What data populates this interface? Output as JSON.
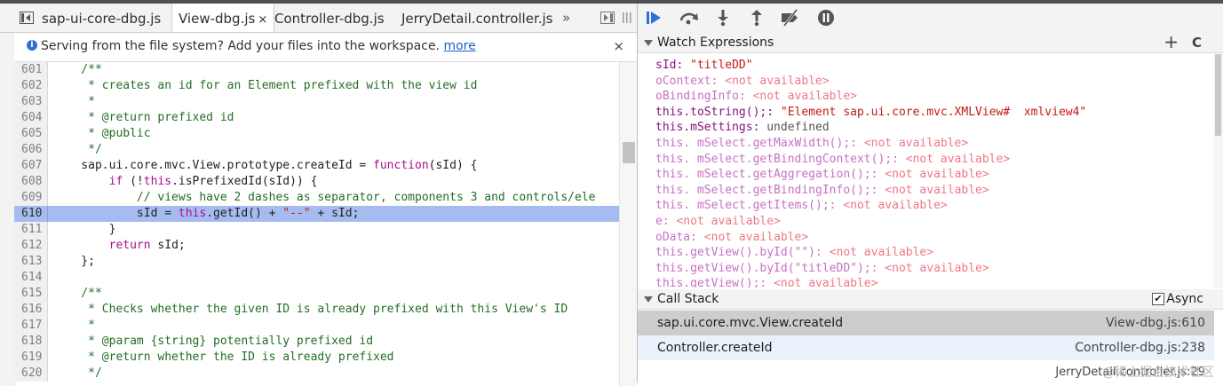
{
  "colors": {
    "highlight": "#a6bcf0",
    "comment": "#236e25",
    "keyword": "#aa0d91",
    "string": "#c41a16",
    "accent": "#2f6fd8"
  },
  "tabs": [
    {
      "label": "sap-ui-core-dbg.js",
      "active": false
    },
    {
      "label": "View-dbg.js",
      "active": true,
      "close": "×"
    },
    {
      "label": "Controller-dbg.js",
      "active": false
    },
    {
      "label": "JerryDetail.controller.js",
      "active": false
    }
  ],
  "tab_overflow": "»",
  "icons": {
    "navigator": "sidebar-toggle-icon",
    "debugger_toggle": "debugger-sidebar-icon",
    "info": "info-icon"
  },
  "infobar": {
    "text": "Serving from the file system? Add your files into the workspace.",
    "link": "more",
    "close": "×"
  },
  "code": {
    "lines": [
      {
        "n": "601",
        "tokens": [
          {
            "t": "    /**",
            "c": "comment"
          }
        ]
      },
      {
        "n": "602",
        "tokens": [
          {
            "t": "     * creates an id for an Element prefixed with the view id",
            "c": "comment"
          }
        ]
      },
      {
        "n": "603",
        "tokens": [
          {
            "t": "     *",
            "c": "comment"
          }
        ]
      },
      {
        "n": "604",
        "tokens": [
          {
            "t": "     * @return prefixed id",
            "c": "comment"
          }
        ]
      },
      {
        "n": "605",
        "tokens": [
          {
            "t": "     * @public",
            "c": "comment"
          }
        ]
      },
      {
        "n": "606",
        "tokens": [
          {
            "t": "     */",
            "c": "comment"
          }
        ]
      },
      {
        "n": "607",
        "tokens": [
          {
            "t": "    sap.ui.core.mvc.View.prototype.createId = ",
            "c": "plain"
          },
          {
            "t": "function",
            "c": "keyword"
          },
          {
            "t": "(sId) {",
            "c": "plain"
          }
        ]
      },
      {
        "n": "608",
        "tokens": [
          {
            "t": "        ",
            "c": "plain"
          },
          {
            "t": "if",
            "c": "keyword"
          },
          {
            "t": " (!",
            "c": "plain"
          },
          {
            "t": "this",
            "c": "keyword"
          },
          {
            "t": ".isPrefixedId(sId)) {",
            "c": "plain"
          }
        ]
      },
      {
        "n": "609",
        "tokens": [
          {
            "t": "            // views have 2 dashes as separator, components 3 and controls/ele",
            "c": "comment"
          }
        ]
      },
      {
        "n": "610",
        "highlight": true,
        "tokens": [
          {
            "t": "            sId = ",
            "c": "plain"
          },
          {
            "t": "this",
            "c": "keyword"
          },
          {
            "t": ".getId() + ",
            "c": "plain"
          },
          {
            "t": "\"--\"",
            "c": "string"
          },
          {
            "t": " + sId;",
            "c": "plain"
          }
        ]
      },
      {
        "n": "611",
        "tokens": [
          {
            "t": "        }",
            "c": "plain"
          }
        ]
      },
      {
        "n": "612",
        "tokens": [
          {
            "t": "        ",
            "c": "plain"
          },
          {
            "t": "return",
            "c": "keyword"
          },
          {
            "t": " sId;",
            "c": "plain"
          }
        ]
      },
      {
        "n": "613",
        "tokens": [
          {
            "t": "    };",
            "c": "plain"
          }
        ]
      },
      {
        "n": "614",
        "tokens": [
          {
            "t": "",
            "c": "plain"
          }
        ]
      },
      {
        "n": "615",
        "tokens": [
          {
            "t": "    /**",
            "c": "comment"
          }
        ]
      },
      {
        "n": "616",
        "tokens": [
          {
            "t": "     * Checks whether the given ID is already prefixed with this View's ID",
            "c": "comment"
          }
        ]
      },
      {
        "n": "617",
        "tokens": [
          {
            "t": "     *",
            "c": "comment"
          }
        ]
      },
      {
        "n": "618",
        "tokens": [
          {
            "t": "     * @param {string} potentially prefixed id",
            "c": "comment"
          }
        ]
      },
      {
        "n": "619",
        "tokens": [
          {
            "t": "     * @return whether the ID is already prefixed",
            "c": "comment"
          }
        ]
      },
      {
        "n": "620",
        "tokens": [
          {
            "t": "     */",
            "c": "comment"
          }
        ]
      }
    ]
  },
  "debugger_toolbar": [
    "resume-icon",
    "step-over-icon",
    "step-into-icon",
    "step-out-icon",
    "deactivate-breakpoints-icon",
    "pause-on-exceptions-icon"
  ],
  "watch": {
    "title": "Watch Expressions",
    "add": "+",
    "refresh": "C",
    "items": [
      {
        "name": "sId",
        "sep": ": ",
        "value": "\"titleDD\"",
        "kind": "string"
      },
      {
        "name": "oContext",
        "sep": ": ",
        "value": "<not available>",
        "kind": "na"
      },
      {
        "name": "oBindingInfo",
        "sep": ": ",
        "value": "<not available>",
        "kind": "na"
      },
      {
        "name": "this.toString();",
        "sep": ": ",
        "value": "\"Element sap.ui.core.mvc.XMLView#  xmlview4\"",
        "kind": "string"
      },
      {
        "name": "this.mSettings",
        "sep": ": ",
        "value": "undefined",
        "kind": "undef"
      },
      {
        "name": "this. mSelect.getMaxWidth();",
        "sep": ": ",
        "value": "<not available>",
        "kind": "na"
      },
      {
        "name": "this. mSelect.getBindingContext();",
        "sep": ": ",
        "value": "<not available>",
        "kind": "na"
      },
      {
        "name": "this. mSelect.getAggregation();",
        "sep": ": ",
        "value": "<not available>",
        "kind": "na"
      },
      {
        "name": "this. mSelect.getBindingInfo();",
        "sep": ": ",
        "value": "<not available>",
        "kind": "na"
      },
      {
        "name": "this. mSelect.getItems();",
        "sep": ": ",
        "value": "<not available>",
        "kind": "na"
      },
      {
        "name": "e",
        "sep": ": ",
        "value": "<not available>",
        "kind": "na"
      },
      {
        "name": "oData",
        "sep": ": ",
        "value": "<not available>",
        "kind": "na"
      },
      {
        "name": "this.getView().byId(\"\")",
        "sep": ": ",
        "value": "<not available>",
        "kind": "na"
      },
      {
        "name": "this.getView().byId(\"titleDD\");",
        "sep": ": ",
        "value": "<not available>",
        "kind": "na"
      },
      {
        "name": "this.getView();",
        "sep": ": ",
        "value": "<not available>",
        "kind": "na"
      }
    ]
  },
  "call_stack": {
    "title": "Call Stack",
    "async_label": "Async",
    "async_checked": true,
    "frames": [
      {
        "fn": "sap.ui.core.mvc.View.createId",
        "loc": "View-dbg.js:610",
        "selected": true
      },
      {
        "fn": "Controller.createId",
        "loc": "Controller-dbg.js:238",
        "selected": false
      },
      {
        "fn": "",
        "loc": "JerryDetail.controller.js:29",
        "selected": false
      }
    ]
  },
  "watermark": "@稀土掘金技术社区"
}
